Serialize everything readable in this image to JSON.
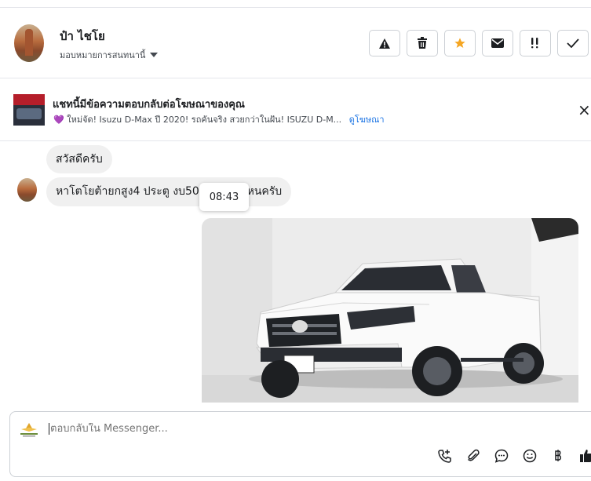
{
  "contact": {
    "name": "ป๋า ไชโย",
    "assign_label": "มอบหมายการสนทนานี้"
  },
  "header_actions": [
    {
      "name": "report-spam-button",
      "icon": "warning-icon"
    },
    {
      "name": "delete-button",
      "icon": "trash-icon"
    },
    {
      "name": "star-button",
      "icon": "star-icon",
      "color": "#f5a623"
    },
    {
      "name": "mark-unread-button",
      "icon": "envelope-icon"
    },
    {
      "name": "follow-up-button",
      "icon": "double-exclamation-icon"
    },
    {
      "name": "mark-done-button",
      "icon": "check-icon"
    }
  ],
  "ad_banner": {
    "title": "แชทนี้มีข้อความตอบกลับต่อโฆษณาของคุณ",
    "subtitle": "💜 ใหม่จัด! Isuzu D-Max ปี 2020! รถคันจริง สวยกว่าในฝัน! ISUZU D-M...",
    "link": "ดูโฆษณา",
    "close": "×"
  },
  "messages": [
    {
      "text": "สวัสดีครับ"
    },
    {
      "text": "หาโตโยต้ายกสูง4 ประตู งบ500,000 มีไหนครับ"
    }
  ],
  "tooltip_time": "08:43",
  "composer": {
    "placeholder": "ตอบกลับใน Messenger..."
  },
  "composer_tools": [
    "add-call-icon",
    "attachment-icon",
    "saved-replies-icon",
    "emoji-icon",
    "baht-payment-icon",
    "thumbs-up-icon"
  ],
  "colors": {
    "accent": "#1b74e4",
    "star": "#f5a623",
    "bubble": "#f0f0f0"
  }
}
